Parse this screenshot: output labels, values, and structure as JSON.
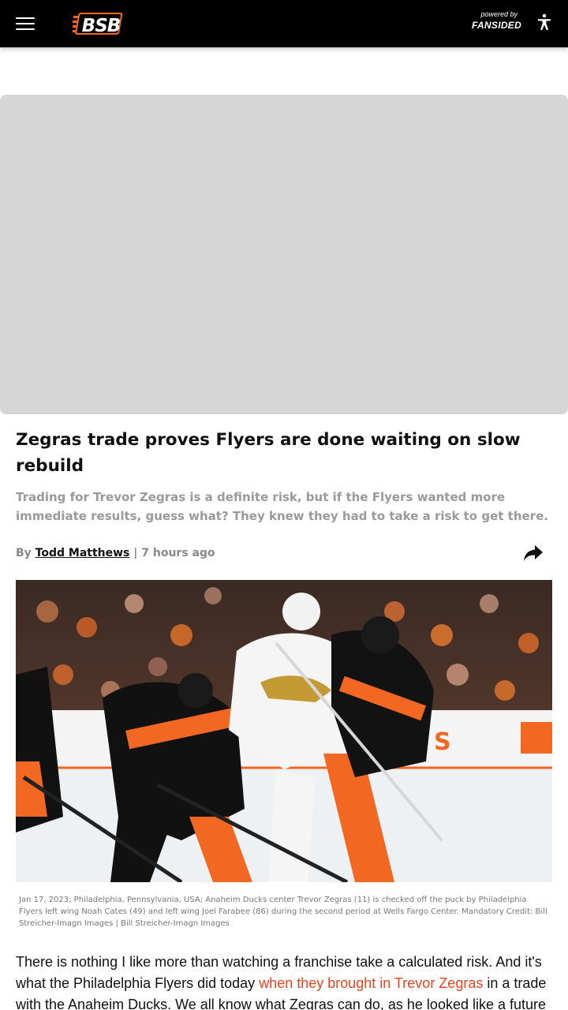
{
  "header": {
    "logo_text": "BSB",
    "powered_by": "powered by",
    "network": "FANSIDED",
    "icons": [
      "hamburger-menu-icon",
      "accessibility-icon"
    ],
    "colors": {
      "bar": "#000000",
      "logo_orange": "#f26722"
    }
  },
  "article": {
    "headline": "Zegras trade proves Flyers are done waiting on slow rebuild",
    "dek": "Trading for Trevor Zegras is a definite risk, but if the Flyers wanted more immediate results, guess what? They knew they had to take a risk to get there.",
    "byline_prefix": "By",
    "author": "Todd Matthews",
    "separator": "|",
    "timestamp": "7 hours ago",
    "share_icon": "share-arrow-icon",
    "caption": "Jan 17, 2023; Philadelphia, Pennsylvania, USA; Anaheim Ducks center Trevor Zegras (11) is checked off the puck by Philadelphia Flyers left wing Noah Cates (49) and left wing Joel Farabee (86) during the second period at Wells Fargo Center. Mandatory Credit: Bill Streicher-Imagn Images | Bill Streicher-Imagn Images",
    "body_start": "There is nothing I like more than watching a franchise take a calculated risk. And it's what the Philadelphia Flyers did today ",
    "body_link": "when they brought in Trevor Zegras",
    "body_end": " in a trade with the Anaheim Ducks. We all know what Zegras can do, as he looked like a future",
    "link_color": "#e8431f"
  }
}
